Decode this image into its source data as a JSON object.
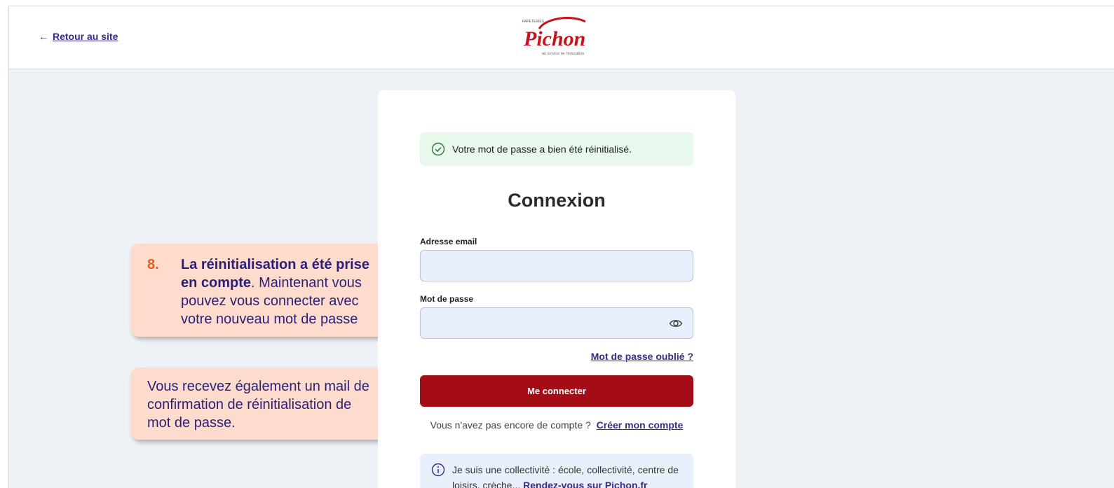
{
  "header": {
    "back_arrow": "←",
    "back_label": "Retour au site",
    "logo_top": "PAPETERIES",
    "logo_name": "Pichon",
    "logo_tagline": "au service de l'éducation"
  },
  "card": {
    "alert_text": "Votre mot de passe a bien été réinitialisé.",
    "title": "Connexion",
    "email_label": "Adresse email",
    "email_value": "",
    "password_label": "Mot de passe",
    "password_value": "",
    "forgot_link": "Mot de passe oublié ?",
    "submit_label": "Me connecter",
    "signup_text": "Vous n'avez pas encore de compte ?",
    "signup_link": "Créer mon compte",
    "info_text": "Je suis une collectivité : école, collectivité, centre de loisirs, crèche...",
    "info_link": "Rendez-vous sur Pichon.fr"
  },
  "callouts": {
    "step_number": "8.",
    "step_bold": "La réinitialisation a été prise en compte",
    "step_rest": ". Maintenant vous pouvez vous connecter avec votre nouveau mot de passe",
    "note": "Vous recevez également un mail de confirmation de réinitialisation de mot de passe."
  },
  "colors": {
    "brand_red": "#a50d16",
    "link_purple": "#3b2a8a",
    "success_bg": "#e8f8ec",
    "callout_bg": "#fddccd",
    "callout_number": "#ea5a12"
  }
}
